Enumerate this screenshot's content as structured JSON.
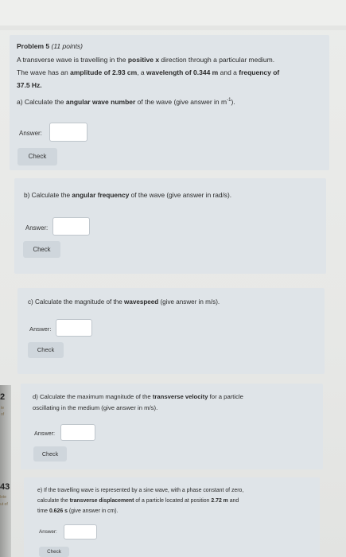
{
  "problem": {
    "title": "Problem 5",
    "points": "(11 points)",
    "intro_line1_a": "A transverse wave is travelling in the ",
    "intro_line1_b": "positive x",
    "intro_line1_c": " direction through a particular medium.",
    "intro_line2_a": "The wave has an ",
    "intro_line2_b": "amplitude of 2.93 cm",
    "intro_line2_c": ", a ",
    "intro_line2_d": "wavelength of 0.344 m",
    "intro_line2_e": " and a ",
    "intro_line2_f": "frequency of",
    "intro_line3": "37.5 Hz."
  },
  "parts": {
    "a": {
      "q_a": "a) Calculate the ",
      "q_b": "angular wave number",
      "q_c": " of the wave (give answer in m",
      "q_sup": "-1",
      "q_d": ").",
      "answer_label": "Answer:",
      "answer_value": "",
      "check_label": "Check"
    },
    "b": {
      "q_a": "b) Calculate the ",
      "q_b": "angular frequency",
      "q_c": " of the wave (give answer in rad/s).",
      "answer_label": "Answer:",
      "answer_value": "",
      "check_label": "Check"
    },
    "c": {
      "q_a": "c) Calculate the magnitude of the ",
      "q_b": "wavespeed",
      "q_c": " (give answer in m/s).",
      "answer_label": "Answer:",
      "answer_value": "",
      "check_label": "Check"
    },
    "d": {
      "q_a": "d) Calculate the maximum magnitude of the ",
      "q_b": "transverse velocity",
      "q_c": " for a particle",
      "q_line2": "oscillating in the medium (give answer in m/s).",
      "answer_label": "Answer:",
      "answer_value": "",
      "check_label": "Check"
    },
    "e": {
      "q_a": "e) If the travelling wave is represented by a sine wave, with a phase constant of zero,",
      "q2_a": "calculate the ",
      "q2_b": "transverse displacement",
      "q2_c": " of a particle located at position ",
      "q2_d": "2.72 m",
      "q2_e": " and",
      "q3_a": "time ",
      "q3_b": "0.626 s",
      "q3_c": " (give answer in cm).",
      "answer_label": "Answer:",
      "answer_value": "",
      "check_label": "Check"
    }
  },
  "sidebar": {
    "num_1": "2",
    "num_1_sub_a": "te",
    "num_1_sub_b": "of",
    "num_2": "43",
    "num_2_sub_a": "lete",
    "num_2_sub_b": "ut of"
  }
}
